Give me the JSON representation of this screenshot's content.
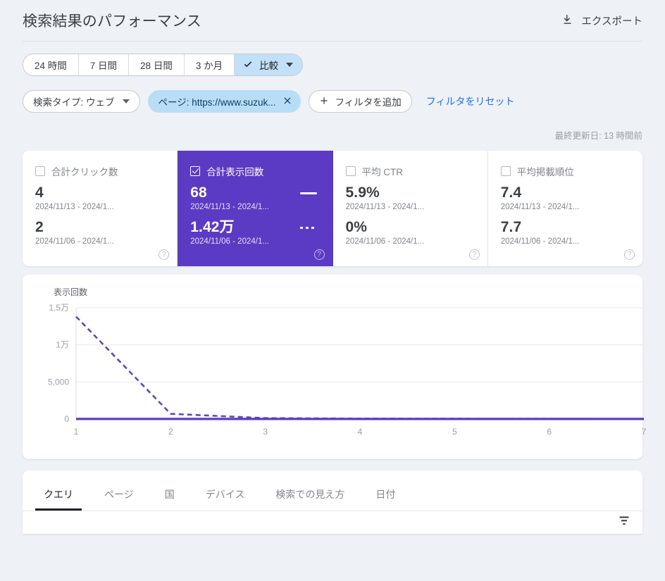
{
  "header": {
    "title": "検索結果のパフォーマンス",
    "export_label": "エクスポート",
    "export_icon": "download-icon"
  },
  "date_range": {
    "options": [
      {
        "label": "24 時間",
        "selected": false
      },
      {
        "label": "7 日間",
        "selected": false
      },
      {
        "label": "28 日間",
        "selected": false
      },
      {
        "label": "3 か月",
        "selected": false
      }
    ],
    "compare": {
      "label": "比較",
      "checked": true,
      "check_icon": "check-icon",
      "caret_icon": "chevron-down-icon"
    }
  },
  "filters": {
    "search_type": {
      "label": "検索タイプ: ウェブ",
      "caret_icon": "chevron-down-icon"
    },
    "page": {
      "label": "ページ: https://www.suzuk...",
      "close_icon": "close-icon",
      "active": true
    },
    "add_filter": {
      "label": "フィルタを追加",
      "plus_icon": "plus-icon"
    },
    "reset": {
      "label": "フィルタをリセット"
    }
  },
  "last_updated": "最終更新日: 13 時間前",
  "metric_cards": [
    {
      "name": "合計クリック数",
      "selected": false,
      "current_value": "4",
      "current_range": "2024/11/13 - 2024/1...",
      "previous_value": "2",
      "previous_range": "2024/11/06 - 2024/1...",
      "help_icon": "help-icon"
    },
    {
      "name": "合計表示回数",
      "selected": true,
      "current_value": "68",
      "current_range": "2024/11/13 - 2024/1...",
      "previous_value": "1.42万",
      "previous_range": "2024/11/06 - 2024/1...",
      "help_icon": "help-icon"
    },
    {
      "name": "平均 CTR",
      "selected": false,
      "current_value": "5.9%",
      "current_range": "2024/11/13 - 2024/1...",
      "previous_value": "0%",
      "previous_range": "2024/11/06 - 2024/1...",
      "help_icon": "help-icon"
    },
    {
      "name": "平均掲載順位",
      "selected": false,
      "current_value": "7.4",
      "current_range": "2024/11/13 - 2024/1...",
      "previous_value": "7.7",
      "previous_range": "2024/11/06 - 2024/1...",
      "help_icon": "help-icon"
    }
  ],
  "chart_data": {
    "type": "line",
    "title": "表示回数",
    "xlabel": "",
    "ylabel": "表示回数",
    "x": [
      1,
      2,
      3,
      4,
      5,
      6,
      7
    ],
    "xticklabels": [
      "1",
      "2",
      "3",
      "4",
      "5",
      "6",
      "7"
    ],
    "yticklabels": [
      "0",
      "5,000",
      "1万",
      "1.5万"
    ],
    "ytickvalues": [
      0,
      5000,
      10000,
      15000
    ],
    "ylim": [
      0,
      15000
    ],
    "grid": true,
    "legend_position": "none",
    "series": [
      {
        "name": "2024/11/13 - 2024/1...",
        "style": "solid",
        "color": "#5b3bc4",
        "values": [
          12,
          14,
          10,
          8,
          9,
          8,
          7
        ]
      },
      {
        "name": "2024/11/06 - 2024/1...",
        "style": "dashed",
        "color": "#5c4bb8",
        "values": [
          13800,
          700,
          120,
          60,
          40,
          30,
          20
        ]
      }
    ]
  },
  "bottom_tabs": [
    {
      "label": "クエリ",
      "active": true
    },
    {
      "label": "ページ",
      "active": false
    },
    {
      "label": "国",
      "active": false
    },
    {
      "label": "デバイス",
      "active": false
    },
    {
      "label": "検索での見え方",
      "active": false
    },
    {
      "label": "日付",
      "active": false
    }
  ],
  "table_controls": {
    "filter_icon": "filter-list-icon"
  },
  "colors": {
    "background": "#eef1f6",
    "selected_card": "#5b3bc4",
    "compare_chip": "#c2e0f7",
    "active_filter_chip": "#b8ddf7",
    "link": "#1a73e8",
    "line_current": "#5b3bc4",
    "line_previous": "#5c4bb8"
  }
}
